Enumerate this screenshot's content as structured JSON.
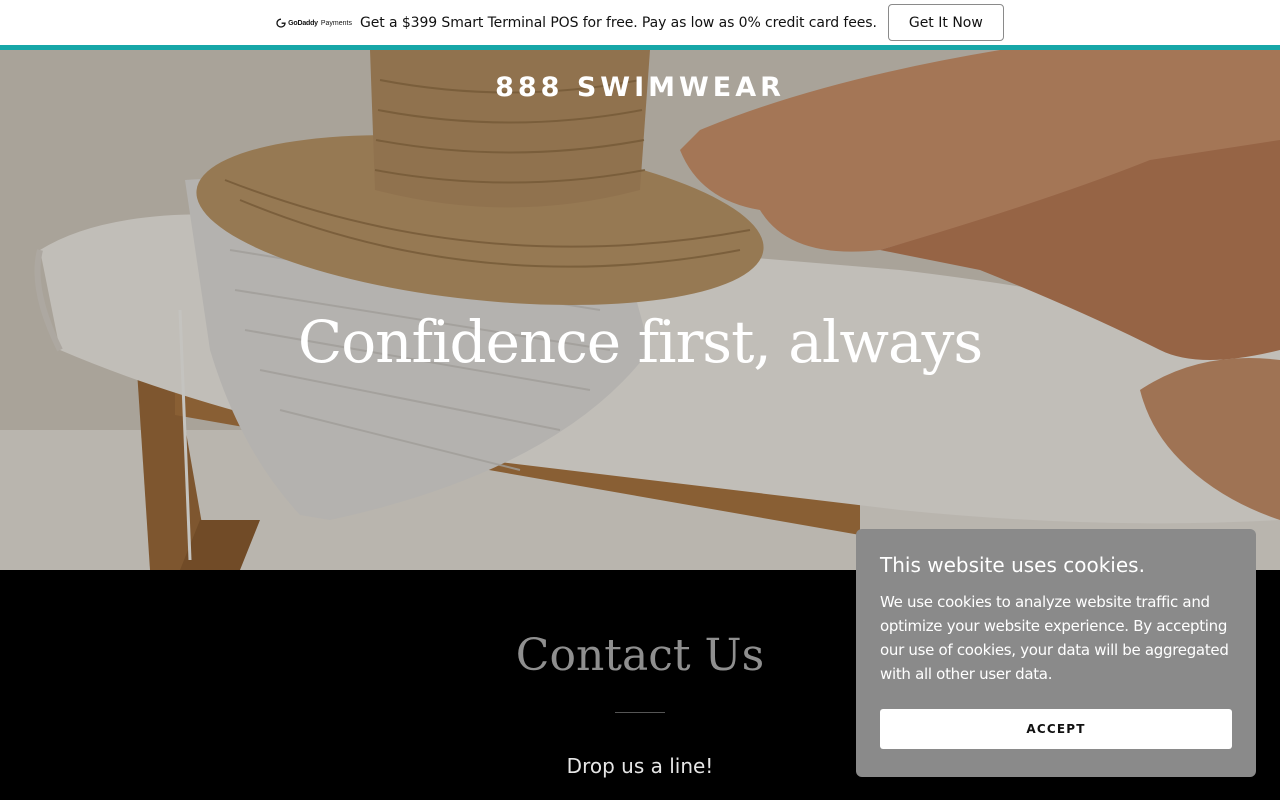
{
  "theme": {
    "accent": "#17a7a8",
    "cookie_bg": "#8a8a8a",
    "contact_bg": "#000000"
  },
  "promo": {
    "logo_brand": "GoDaddy",
    "logo_sub": "Payments",
    "text": "Get a $399 Smart Terminal POS for free. Pay as low as 0% credit card fees.",
    "button_label": "Get It Now"
  },
  "hero": {
    "brand": "888 SWIMWEAR",
    "headline": "Confidence first, always"
  },
  "contact": {
    "title": "Contact Us",
    "subtitle": "Drop us a line!"
  },
  "cookie": {
    "title": "This website uses cookies.",
    "body": "We use cookies to analyze website traffic and optimize your website experience. By accepting our use of cookies, your data will be aggregated with all other user data.",
    "accept_label": "ACCEPT"
  }
}
